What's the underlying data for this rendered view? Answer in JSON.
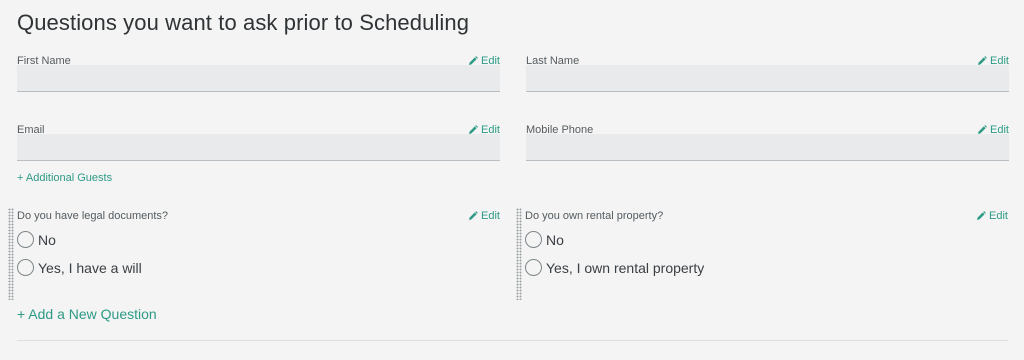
{
  "page": {
    "title": "Questions you want to ask prior to Scheduling"
  },
  "fields": {
    "first_name": {
      "label": "First Name",
      "edit_label": "Edit",
      "value": ""
    },
    "last_name": {
      "label": "Last Name",
      "edit_label": "Edit",
      "value": ""
    },
    "email": {
      "label": "Email",
      "edit_label": "Edit",
      "value": ""
    },
    "mobile_phone": {
      "label": "Mobile Phone",
      "edit_label": "Edit",
      "value": ""
    }
  },
  "additional_guests_label": "+ Additional Guests",
  "questions": [
    {
      "label": "Do you have legal documents?",
      "edit_label": "Edit",
      "options": [
        "No",
        "Yes, I have a will"
      ]
    },
    {
      "label": "Do you own rental property?",
      "edit_label": "Edit",
      "options": [
        "No",
        "Yes, I own rental property"
      ]
    }
  ],
  "add_question_label": "+ Add a New Question",
  "colors": {
    "accent": "#2e9a86",
    "background": "#f3f4f3",
    "input_background": "#e8eaeb"
  },
  "icons": {
    "edit": "pencil-icon",
    "drag": "drag-handle-icon",
    "radio": "radio-unchecked-icon"
  }
}
